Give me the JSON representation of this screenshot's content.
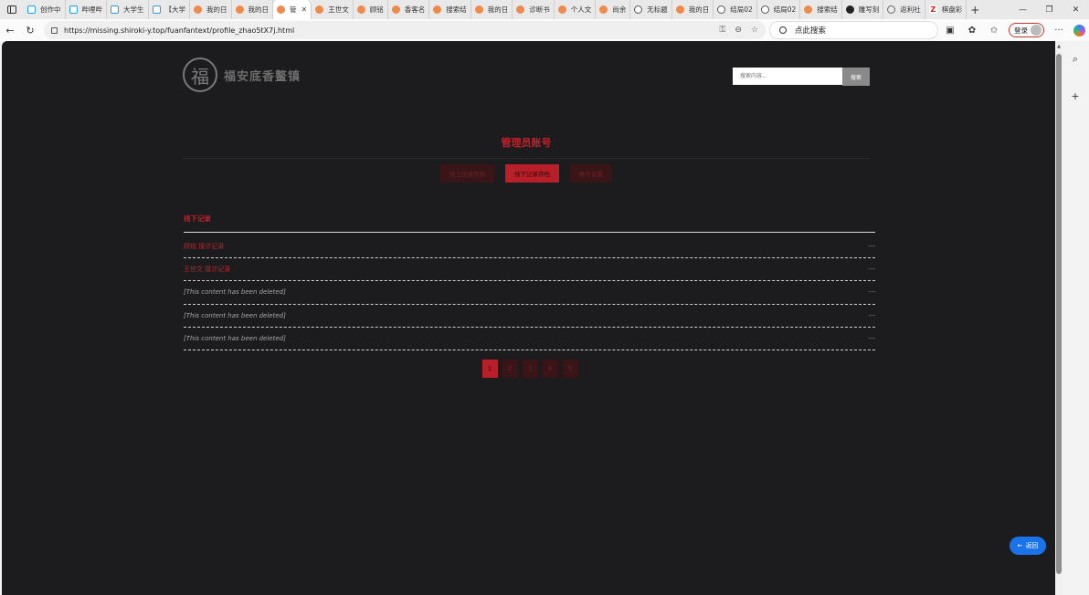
{
  "browser": {
    "tabs": [
      {
        "label": "创作中",
        "icon": "bili"
      },
      {
        "label": "哔哩哔",
        "icon": "bili"
      },
      {
        "label": "大学生",
        "icon": "bili"
      },
      {
        "label": "【大学",
        "icon": "bili"
      },
      {
        "label": "我的日",
        "icon": "orange"
      },
      {
        "label": "我的日",
        "icon": "orange"
      },
      {
        "label": "管",
        "icon": "orange",
        "active": true
      },
      {
        "label": "王世文",
        "icon": "orange"
      },
      {
        "label": "顾铭",
        "icon": "orange"
      },
      {
        "label": "香客名",
        "icon": "orange"
      },
      {
        "label": "搜索结",
        "icon": "orange"
      },
      {
        "label": "我的日",
        "icon": "orange"
      },
      {
        "label": "诊断书",
        "icon": "orange"
      },
      {
        "label": "个人文",
        "icon": "orange"
      },
      {
        "label": "尚余",
        "icon": "orange"
      },
      {
        "label": "无标题",
        "icon": "globe"
      },
      {
        "label": "我的日",
        "icon": "orange"
      },
      {
        "label": "结局02",
        "icon": "globe"
      },
      {
        "label": "结局02",
        "icon": "globe"
      },
      {
        "label": "搜索结",
        "icon": "orange"
      },
      {
        "label": "雕写刻",
        "icon": "dark"
      },
      {
        "label": "返利社",
        "icon": "search"
      },
      {
        "label": "棋盘彩",
        "icon": "zhi"
      }
    ],
    "url": "https://missing.shiroki-y.top/fuanfantext/profile_zhao5tX7j.html",
    "search_placeholder": "点此搜索",
    "login_label": "登录"
  },
  "site": {
    "logo_seal": "福",
    "logo_name": "福安底香鳌镇",
    "search_placeholder": "搜索内容...",
    "search_button": "搜索"
  },
  "profile": {
    "title": "管理员账号",
    "tabs": [
      {
        "label": "线上回收存档",
        "active": false
      },
      {
        "label": "线下记录存档",
        "active": true
      },
      {
        "label": "账号设置",
        "active": false
      }
    ],
    "section_title": "线下记录",
    "records": [
      {
        "text": "顾铭 接诊记录",
        "meta": "---",
        "deleted": false
      },
      {
        "text": "王世文 接诊记录",
        "meta": "---",
        "deleted": false
      },
      {
        "text": "[This content has been deleted]",
        "meta": "---",
        "deleted": true
      },
      {
        "text": "[This content has been deleted]",
        "meta": "---",
        "deleted": true
      },
      {
        "text": "[This content has been deleted]",
        "meta": "---",
        "deleted": true
      }
    ],
    "pages": [
      "1",
      "2",
      "3",
      "4",
      "5"
    ],
    "current_page": "1"
  },
  "back_button": "返回"
}
